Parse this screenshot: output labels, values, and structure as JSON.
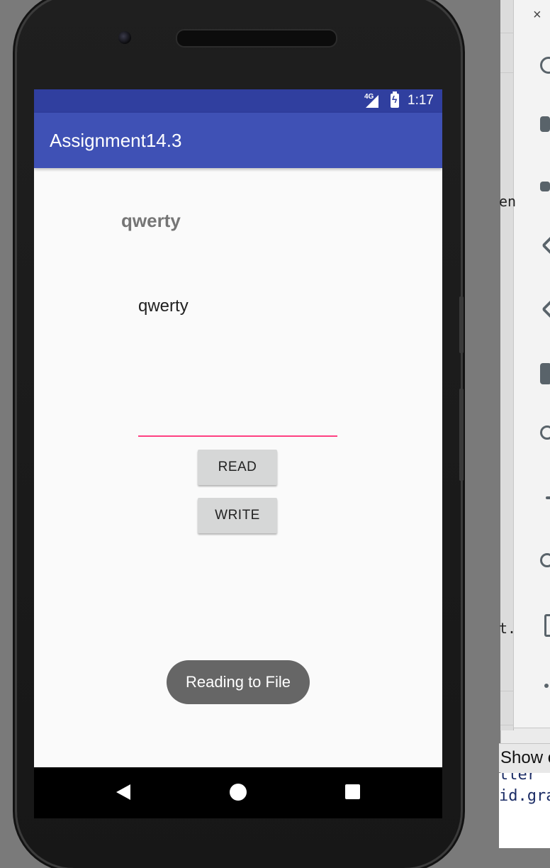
{
  "status_bar": {
    "network": "4G",
    "time": "1:17",
    "icons": [
      "signal-icon",
      "battery-charging-icon"
    ]
  },
  "app_bar": {
    "title": "Assignment14.3"
  },
  "content": {
    "label_bold": "qwerty",
    "label_plain": "qwerty",
    "input_value": "",
    "read_button": "READ",
    "write_button": "WRITE"
  },
  "toast": {
    "message": "Reading to File"
  },
  "nav_bar": {
    "icons": [
      "back-icon",
      "home-icon",
      "recents-icon"
    ]
  },
  "ide_panel": {
    "close_glyph": "×",
    "fragment_1": "en",
    "fragment_2": "t.",
    "show_label": "Show c",
    "code_line_1": "tter",
    "code_line_2": "id.gra"
  },
  "colors": {
    "status_bar": "#303f9f",
    "app_bar": "#3f51b5",
    "accent": "#ff4081",
    "button": "#d6d7d7",
    "toast": "#666666"
  }
}
